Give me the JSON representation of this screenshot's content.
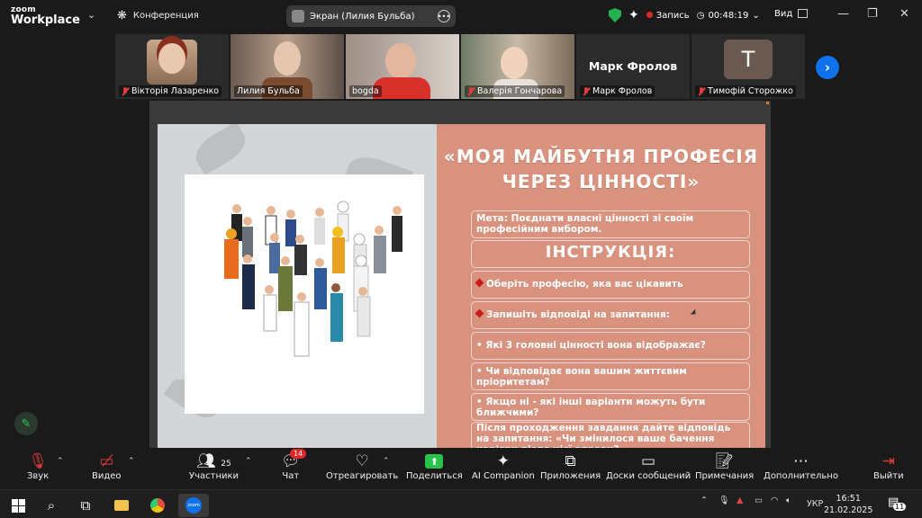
{
  "app": {
    "logo_top": "zoom",
    "logo_bottom": "Workplace",
    "conference_label": "Конференция"
  },
  "screen_pill": {
    "label": "Экран (Лилия Бульба)"
  },
  "header_right": {
    "record_label": "Запись",
    "timer": "00:48:19",
    "view_label": "Вид"
  },
  "participants": [
    {
      "name": "Вікторія Лазаренко",
      "muted": true
    },
    {
      "name": "Лилия Бульба",
      "muted": false
    },
    {
      "name": "bogda",
      "muted": false,
      "active": true
    },
    {
      "name": "Валерія Гончарова",
      "muted": true
    },
    {
      "name": "Марк Фролов",
      "muted": true,
      "big_name": "Марк Фролов"
    },
    {
      "name": "Тимофій Сторожко",
      "muted": true,
      "initial": "T"
    }
  ],
  "slide": {
    "title_line1": "«МОЯ МАЙБУТНЯ ПРОФЕСІЯ",
    "title_line2": "ЧЕРЕЗ ЦІННОСТІ»",
    "goal": "Мета: Поєднати власні цінності зі своїм професійним вибором.",
    "instructions_heading": "ІНСТРУКЦІЯ:",
    "step1": "Оберіть професію, яка вас цікавить",
    "step2": "Запишіть відповіді на запитання:",
    "q1": "• Які 3 головні цінності вона відображає?",
    "q2": "• Чи відповідає вона вашим життєвим пріоритетам?",
    "q3": "• Якщо ні - які інші варіанти можуть бути ближчими?",
    "after": "Після проходження завдання дайте відповідь на запитання: «Чи змінилося ваше бачення кар'єри після цієї вправи?»"
  },
  "toolbar": {
    "audio": "Звук",
    "video": "Видео",
    "participants": "Участники",
    "participants_count": "25",
    "chat": "Чат",
    "chat_badge": "14",
    "react": "Отреагировать",
    "share": "Поделиться",
    "ai": "AI Companion",
    "apps": "Приложения",
    "whiteboards": "Доски сообщений",
    "notes": "Примечания",
    "more": "Дополнительно",
    "leave": "Выйти"
  },
  "taskbar": {
    "lang": "УКР",
    "time": "16:51",
    "date": "21.02.2025",
    "notif_count": "11"
  },
  "colors": {
    "accent_green": "#27c34a",
    "slide_salmon": "#d9927e",
    "zoom_blue": "#0e72ed",
    "alert_red": "#e02828"
  }
}
